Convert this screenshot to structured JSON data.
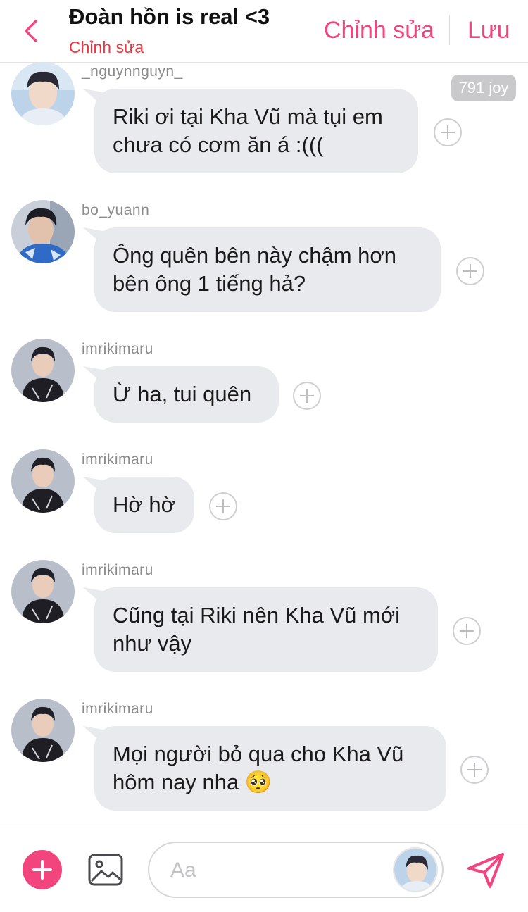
{
  "header": {
    "title": "Đoàn hồn is real <3",
    "subtitle": "Chỉnh sửa",
    "edit_label": "Chỉnh sửa",
    "save_label": "Lưu"
  },
  "joy_badge": "791 joy",
  "messages": [
    {
      "username": "_nguynnguyn_",
      "text_lines": [
        "Riki ơi tại Kha Vũ mà tụi em",
        "chưa có cơm ăn á :((("
      ]
    },
    {
      "username": "bo_yuann",
      "text_lines": [
        "Ông quên bên này chậm hơn",
        "bên ông 1 tiếng hả?"
      ]
    },
    {
      "username": "imrikimaru",
      "text_lines": [
        "Ừ ha, tui quên"
      ]
    },
    {
      "username": "imrikimaru",
      "text_lines": [
        "Hờ hờ"
      ]
    },
    {
      "username": "imrikimaru",
      "text_lines": [
        "Cũng tại Riki nên Kha Vũ mới",
        "như vậy"
      ]
    },
    {
      "username": "imrikimaru",
      "text_lines": [
        "Mọi người bỏ qua cho Kha Vũ",
        "hôm nay nha 🥺"
      ]
    }
  ],
  "composer": {
    "placeholder": "Aa"
  },
  "colors": {
    "accent": "#f2457e",
    "subtitle_red": "#f0343f",
    "bubble_bg": "#e9eaed"
  },
  "icons": {
    "back": "chevron-left-icon",
    "add_reaction": "plus-circle-icon",
    "add": "plus-icon",
    "image": "image-icon",
    "send": "send-icon"
  }
}
